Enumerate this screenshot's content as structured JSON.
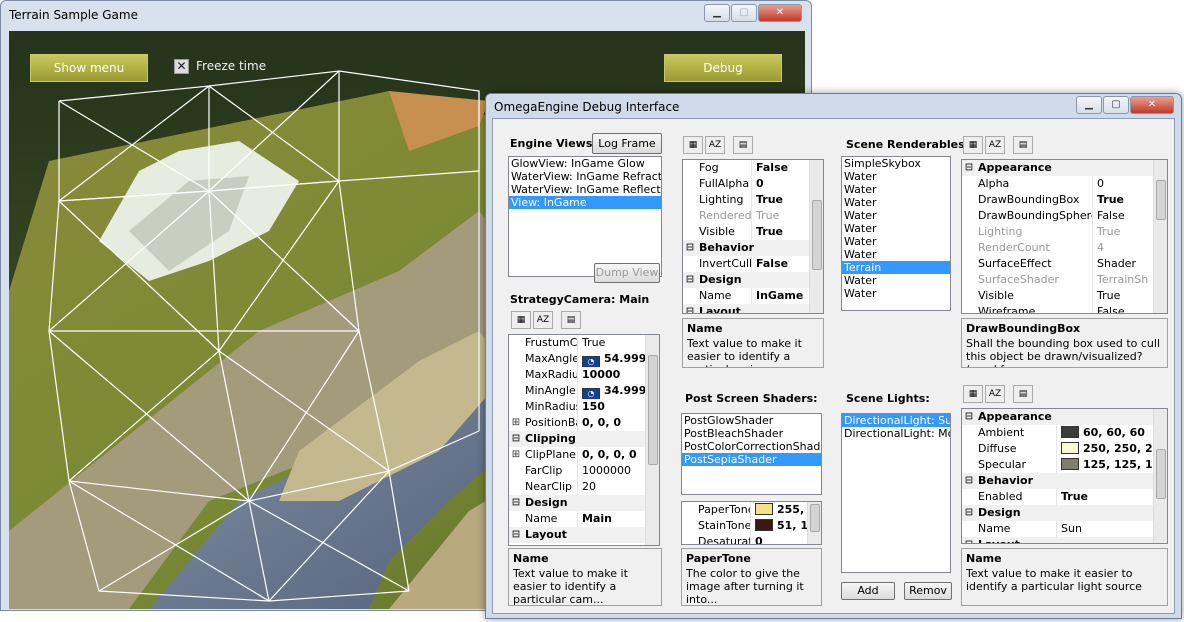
{
  "game_window": {
    "title": "Terrain Sample Game",
    "show_menu": "Show menu",
    "freeze_time": "Freeze time",
    "debug": "Debug"
  },
  "debug_window": {
    "title": "OmegaEngine Debug Interface",
    "engine_views": {
      "label": "Engine Views:",
      "log_frame": "Log Frame",
      "dump_view": "Dump View",
      "items": [
        "GlowView: InGame Glow",
        "WaterView: InGame Refraction",
        "WaterView: InGame Reflection",
        "View: InGame"
      ]
    },
    "view_props": {
      "rows": [
        {
          "n": "Fog",
          "v": "False",
          "bold": true
        },
        {
          "n": "FullAlpha",
          "v": "0",
          "bold": true
        },
        {
          "n": "Lighting",
          "v": "True",
          "bold": true
        },
        {
          "n": "Rendered",
          "v": "True",
          "gray": true
        },
        {
          "n": "Visible",
          "v": "True",
          "bold": true
        },
        {
          "cat": "Behavior"
        },
        {
          "n": "InvertCull",
          "v": "False",
          "bold": true
        },
        {
          "cat": "Design"
        },
        {
          "n": "Name",
          "v": "InGame",
          "bold": true
        },
        {
          "cat": "Layout"
        }
      ],
      "desc_title": "Name",
      "desc_text": "Text value to make it easier to identify a particular view"
    },
    "camera": {
      "label": "StrategyCamera: Main",
      "rows": [
        {
          "n": "FrustumCu",
          "v": "True"
        },
        {
          "n": "MaxAngle",
          "v": "54.999",
          "bold": true,
          "icon": true
        },
        {
          "n": "MaxRadius",
          "v": "10000",
          "bold": true
        },
        {
          "n": "MinAngle",
          "v": "34.999",
          "bold": true,
          "icon": true
        },
        {
          "n": "MinRadius",
          "v": "150",
          "bold": true
        },
        {
          "n": "PositionBa",
          "v": "0, 0, 0",
          "bold": true,
          "exp": "+"
        },
        {
          "cat": "Clipping"
        },
        {
          "n": "ClipPlane",
          "v": "0, 0, 0, 0",
          "bold": true,
          "exp": "+"
        },
        {
          "n": "FarClip",
          "v": "1000000"
        },
        {
          "n": "NearClip",
          "v": "20"
        },
        {
          "cat": "Design"
        },
        {
          "n": "Name",
          "v": "Main",
          "bold": true
        },
        {
          "cat": "Layout"
        }
      ],
      "desc_title": "Name",
      "desc_text": "Text value to make it easier to identify a particular cam..."
    },
    "post_shaders": {
      "label": "Post Screen Shaders:",
      "items": [
        "PostGlowShader",
        "PostBleachShader",
        "PostColorCorrectionShader",
        "PostSepiaShader"
      ],
      "rows": [
        {
          "n": "PaperTone",
          "v": "255, 2",
          "bold": true,
          "color": "#f8e088"
        },
        {
          "n": "StainTone",
          "v": "51, 1",
          "bold": true,
          "color": "#3a1a10"
        },
        {
          "n": "Desaturat",
          "v": "0",
          "bold": true
        }
      ],
      "desc_title": "PaperTone",
      "desc_text": "The color to give the image after turning it into..."
    },
    "renderables": {
      "label": "Scene Renderables:",
      "items": [
        "SimpleSkybox",
        "Water",
        "Water",
        "Water",
        "Water",
        "Water",
        "Water",
        "Water",
        "Terrain",
        "Water",
        "Water"
      ],
      "rows": [
        {
          "cat": "Appearance"
        },
        {
          "n": "Alpha",
          "v": "0"
        },
        {
          "n": "DrawBoundingBox",
          "v": "True",
          "bold": true
        },
        {
          "n": "DrawBoundingSphere",
          "v": "False"
        },
        {
          "n": "Lighting",
          "v": "True",
          "gray": true
        },
        {
          "n": "RenderCount",
          "v": "4",
          "gray": true
        },
        {
          "n": "SurfaceEffect",
          "v": "Shader"
        },
        {
          "n": "SurfaceShader",
          "v": "TerrainSh",
          "gray": true
        },
        {
          "n": "Visible",
          "v": "True"
        },
        {
          "n": "Wireframe",
          "v": "False"
        }
      ],
      "desc_title": "DrawBoundingBox",
      "desc_text": "Shall the bounding box used to cull this object be drawn/visualized? (used for..."
    },
    "lights": {
      "label": "Scene Lights:",
      "items": [
        "DirectionalLight: Sun",
        "DirectionalLight: Moon"
      ],
      "add": "Add",
      "remove": "Remov",
      "rows": [
        {
          "cat": "Appearance"
        },
        {
          "n": "Ambient",
          "v": "60, 60, 60",
          "bold": true,
          "color": "#3c3c3c"
        },
        {
          "n": "Diffuse",
          "v": "250, 250, 2",
          "bold": true,
          "color": "#fafad2"
        },
        {
          "n": "Specular",
          "v": "125, 125, 1",
          "bold": true,
          "color": "#7d7d6a"
        },
        {
          "cat": "Behavior"
        },
        {
          "n": "Enabled",
          "v": "True",
          "bold": true
        },
        {
          "cat": "Design"
        },
        {
          "n": "Name",
          "v": "Sun"
        },
        {
          "cat": "Layout"
        }
      ],
      "desc_title": "Name",
      "desc_text": "Text value to make it easier to identify a particular light source"
    }
  }
}
